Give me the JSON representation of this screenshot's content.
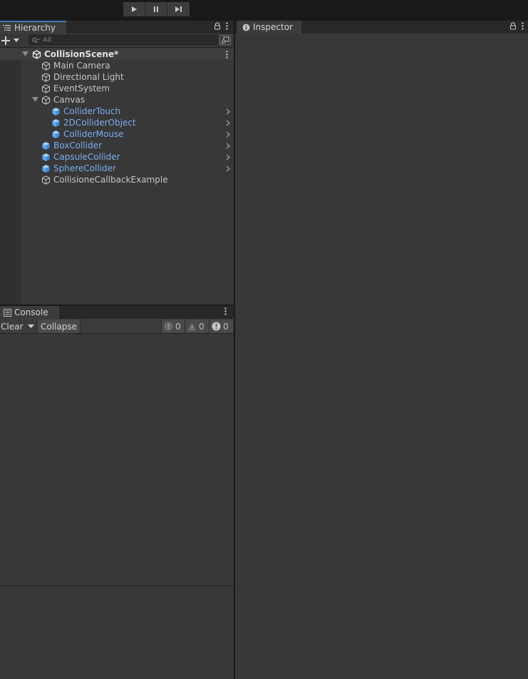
{
  "toolbar": {
    "play": "play-icon",
    "pause": "pause-icon",
    "step": "step-icon"
  },
  "hierarchy": {
    "tab_label": "Hierarchy",
    "search_placeholder": "All",
    "scene": {
      "name": "CollisionScene*"
    },
    "items": [
      {
        "label": "Main Camera",
        "depth": 1,
        "prefab": false
      },
      {
        "label": "Directional Light",
        "depth": 1,
        "prefab": false
      },
      {
        "label": "EventSystem",
        "depth": 1,
        "prefab": false
      },
      {
        "label": "Canvas",
        "depth": 1,
        "prefab": false,
        "expanded": true
      },
      {
        "label": "ColliderTouch",
        "depth": 2,
        "prefab": true
      },
      {
        "label": "2DColliderObject",
        "depth": 2,
        "prefab": true
      },
      {
        "label": "ColliderMouse",
        "depth": 2,
        "prefab": true
      },
      {
        "label": "BoxCollider",
        "depth": 1,
        "prefab": true
      },
      {
        "label": "CapsuleCollider",
        "depth": 1,
        "prefab": true
      },
      {
        "label": "SphereCollider",
        "depth": 1,
        "prefab": true
      },
      {
        "label": "CollisioneCallbackExample",
        "depth": 1,
        "prefab": false
      }
    ]
  },
  "console": {
    "tab_label": "Console",
    "clear_label": "Clear",
    "collapse_label": "Collapse",
    "counts": {
      "log": "0",
      "warning": "0",
      "error": "0"
    }
  },
  "inspector": {
    "tab_label": "Inspector"
  },
  "colors": {
    "prefab_text": "#7bacf0",
    "prefab_icon": "#5fa8f0",
    "active_tab_line": "#3a79bb"
  }
}
